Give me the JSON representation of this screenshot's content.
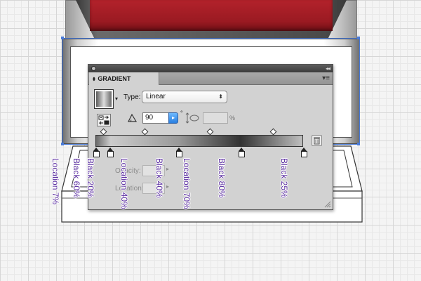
{
  "panel": {
    "tab_title": "GRADIENT",
    "collapse_glyph": "◂◂",
    "menu_glyph": "▾≡",
    "type_label": "Type:",
    "type_value": "Linear",
    "type_select_glyph": "⬍",
    "angle_value": "90",
    "angle_degree_glyph": "°",
    "aspect_percent": "%",
    "opacity_label": "Opacity:",
    "location_label": "Location:",
    "location_percent": "%",
    "swatch_arrow_glyph": "▾",
    "dropdown_glyph": "▸"
  },
  "gradient_stops": [
    {
      "color": "Black 60%",
      "location": 0
    },
    {
      "color": "Black 20%",
      "location": 7
    },
    {
      "color": "Black 40%",
      "location": 40
    },
    {
      "color": "Black 80%",
      "location": 70
    },
    {
      "color": "Black 25%",
      "location": 100
    }
  ],
  "annotations": [
    {
      "lines": [
        "Black 60%"
      ]
    },
    {
      "lines": [
        "Black 20%",
        "Location 7%"
      ]
    },
    {
      "lines": [
        "Black 40%",
        "Location 40%"
      ]
    },
    {
      "lines": [
        "Black 80%",
        "Location 70%"
      ]
    },
    {
      "lines": [
        "Black 25%"
      ]
    }
  ],
  "colors": {
    "annotation_text": "#5a2da0",
    "selection_blue": "#4a7bd8",
    "artwork_red": "#b3222b",
    "panel_bg": "#d2d2d2"
  }
}
